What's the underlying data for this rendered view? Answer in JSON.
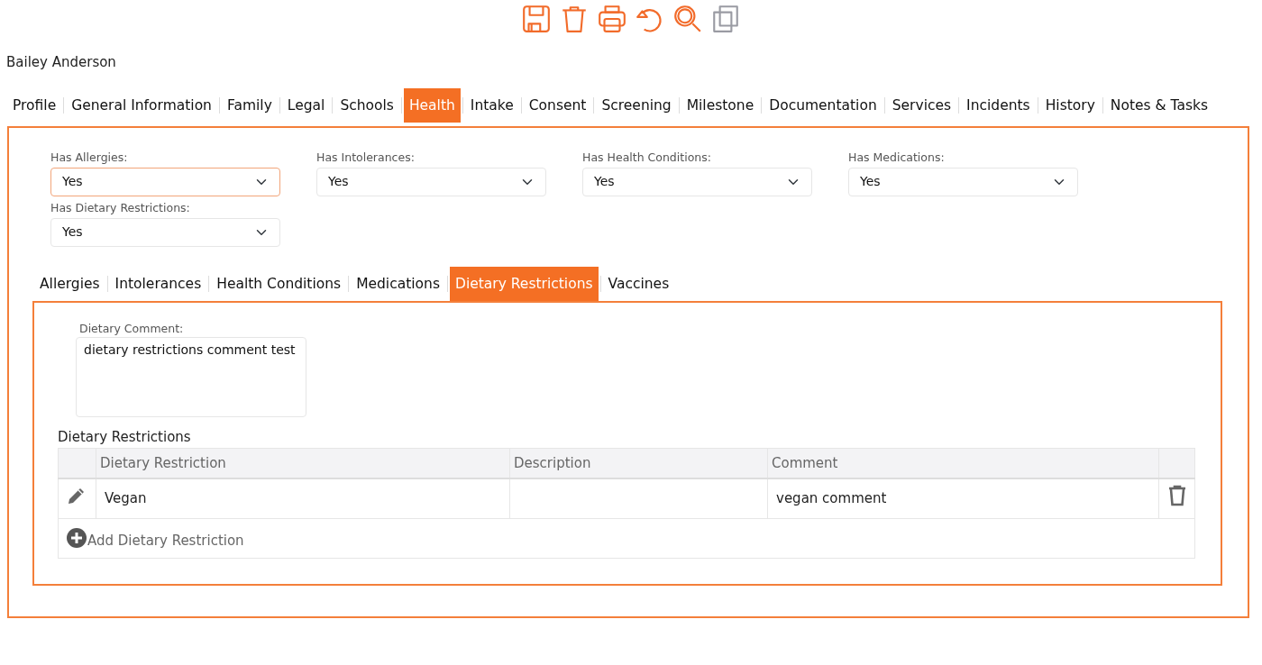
{
  "toolbar": [
    {
      "kind": "save",
      "disabled": false
    },
    {
      "kind": "delete",
      "disabled": false
    },
    {
      "kind": "print",
      "disabled": false
    },
    {
      "kind": "undo",
      "disabled": false
    },
    {
      "kind": "search",
      "disabled": false
    },
    {
      "kind": "copy",
      "disabled": true
    }
  ],
  "person_name": "Bailey Anderson",
  "main_tabs": [
    {
      "label": "Profile",
      "selected": false
    },
    {
      "label": "General Information",
      "selected": false
    },
    {
      "label": "Family",
      "selected": false
    },
    {
      "label": "Legal",
      "selected": false
    },
    {
      "label": "Schools",
      "selected": false
    },
    {
      "label": "Health",
      "selected": true
    },
    {
      "label": "Intake",
      "selected": false
    },
    {
      "label": "Consent",
      "selected": false
    },
    {
      "label": "Screening",
      "selected": false
    },
    {
      "label": "Milestone",
      "selected": false
    },
    {
      "label": "Documentation",
      "selected": false
    },
    {
      "label": "Services",
      "selected": false
    },
    {
      "label": "Incidents",
      "selected": false
    },
    {
      "label": "History",
      "selected": false
    },
    {
      "label": "Notes & Tasks",
      "selected": false
    }
  ],
  "health_questions": [
    {
      "label": "Has Allergies:",
      "value": "Yes",
      "focused": true
    },
    {
      "label": "Has Intolerances:",
      "value": "Yes",
      "focused": false
    },
    {
      "label": "Has Health Conditions:",
      "value": "Yes",
      "focused": false
    },
    {
      "label": "Has Medications:",
      "value": "Yes",
      "focused": false
    },
    {
      "label": "Has Dietary Restrictions:",
      "value": "Yes",
      "focused": false
    }
  ],
  "sub_tabs": [
    {
      "label": "Allergies",
      "selected": false
    },
    {
      "label": "Intolerances",
      "selected": false
    },
    {
      "label": "Health Conditions",
      "selected": false
    },
    {
      "label": "Medications",
      "selected": false
    },
    {
      "label": "Dietary Restrictions",
      "selected": true
    },
    {
      "label": "Vaccines",
      "selected": false
    }
  ],
  "dietary_comment": {
    "label": "Dietary Comment:",
    "value": "dietary restrictions comment test"
  },
  "table": {
    "title": "Dietary Restrictions",
    "columns": [
      "Dietary Restriction",
      "Description",
      "Comment"
    ],
    "rows": [
      {
        "dietary_restriction": "Vegan",
        "comment": "vegan comment"
      }
    ],
    "add_label": "Add Dietary Restriction"
  }
}
